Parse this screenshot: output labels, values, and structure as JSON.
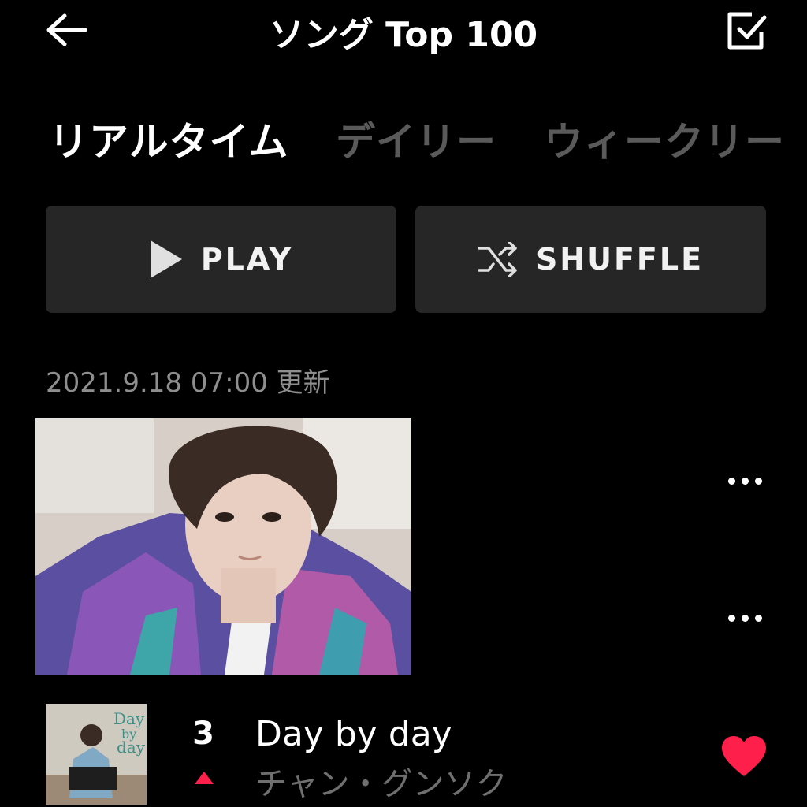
{
  "header": {
    "title": "ソング Top 100",
    "back_icon": "arrow-left-icon",
    "select_icon": "checkbox-check-icon"
  },
  "tabs": [
    {
      "label": "リアルタイム",
      "active": true
    },
    {
      "label": "デイリー",
      "active": false
    },
    {
      "label": "ウィークリー",
      "active": false
    }
  ],
  "actions": {
    "play_label": "PLAY",
    "shuffle_label": "SHUFFLE"
  },
  "updated_text": "2021.9.18 07:00 更新",
  "colors": {
    "background": "#000000",
    "button_bg": "#262626",
    "accent": "#ff1f4b",
    "muted_text": "#6f6f6f"
  },
  "songs": [
    {
      "rank": "3",
      "rank_change": "up",
      "title": "Day by day",
      "artist": "チャン・グンソク",
      "liked": true,
      "thumb_text": "Day by day"
    }
  ]
}
